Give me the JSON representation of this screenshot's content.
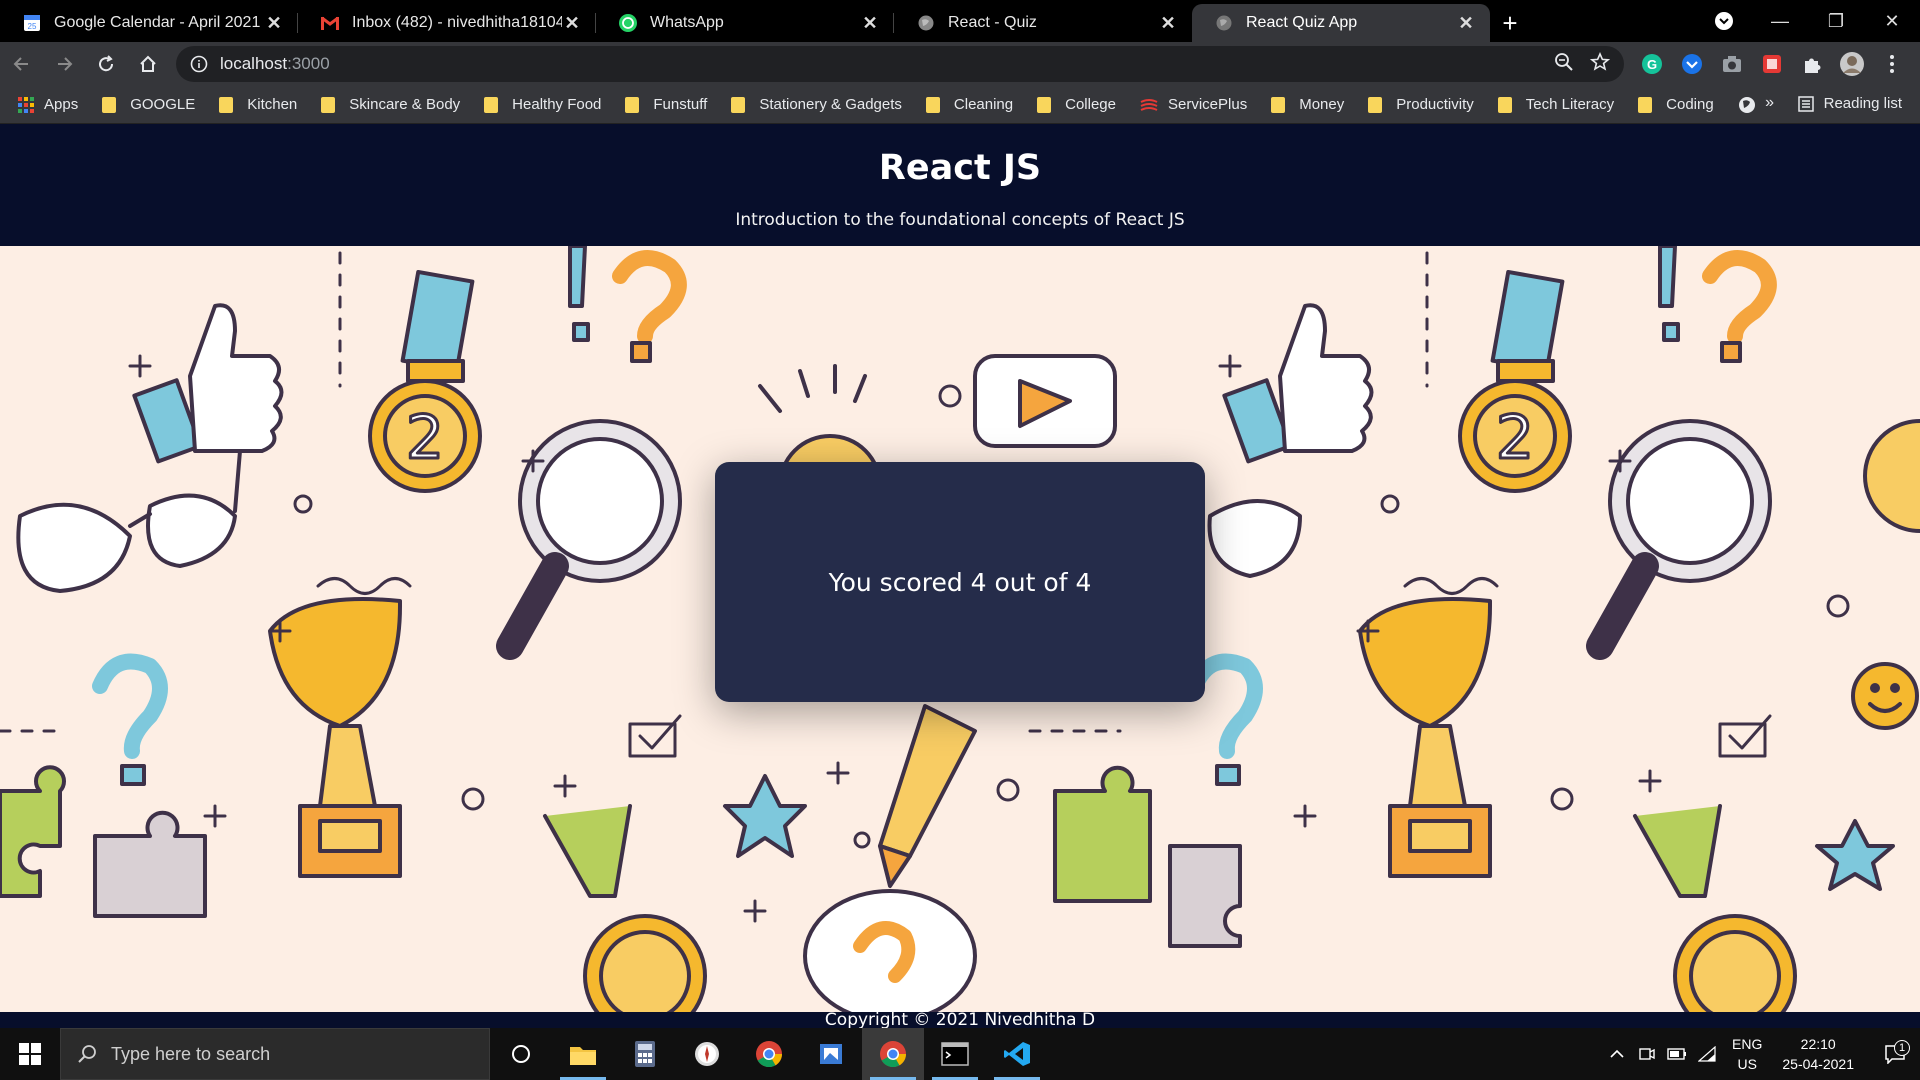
{
  "browser": {
    "tabs": [
      {
        "title": "Google Calendar - April 2021",
        "icon": "calendar-icon"
      },
      {
        "title": "Inbox (482) - nivedhitha18104@c",
        "icon": "gmail-icon"
      },
      {
        "title": "WhatsApp",
        "icon": "whatsapp-icon"
      },
      {
        "title": "React - Quiz",
        "icon": "globe-icon"
      },
      {
        "title": "React Quiz App",
        "icon": "globe-icon"
      }
    ],
    "active_tab": 4,
    "url_host": "localhost",
    "url_port": ":3000",
    "bookmarks": [
      "Apps",
      "GOOGLE",
      "Kitchen",
      "Skincare & Body",
      "Healthy Food",
      "Funstuff",
      "Stationery & Gadgets",
      "Cleaning",
      "College",
      "ServicePlus",
      "Money",
      "Productivity",
      "Tech Literacy",
      "Coding"
    ],
    "overflow_label": "»",
    "reading_list": "Reading list"
  },
  "page": {
    "title": "React JS",
    "subtitle": "Introduction to the foundational concepts of React JS",
    "score_text": "You scored 4 out of 4",
    "footer": "Copyright © 2021 Nivedhitha D"
  },
  "taskbar": {
    "search_placeholder": "Type here to search",
    "lang_top": "ENG",
    "lang_bottom": "US",
    "time": "22:10",
    "date": "25-04-2021",
    "notification_count": "1"
  },
  "colors": {
    "header_bg": "#070e2b",
    "card_bg": "#252c4a",
    "page_bg": "#fdeee4",
    "accent_yellow": "#f5b82e",
    "accent_blue": "#7ec8dc",
    "accent_green": "#b6cf5c"
  }
}
